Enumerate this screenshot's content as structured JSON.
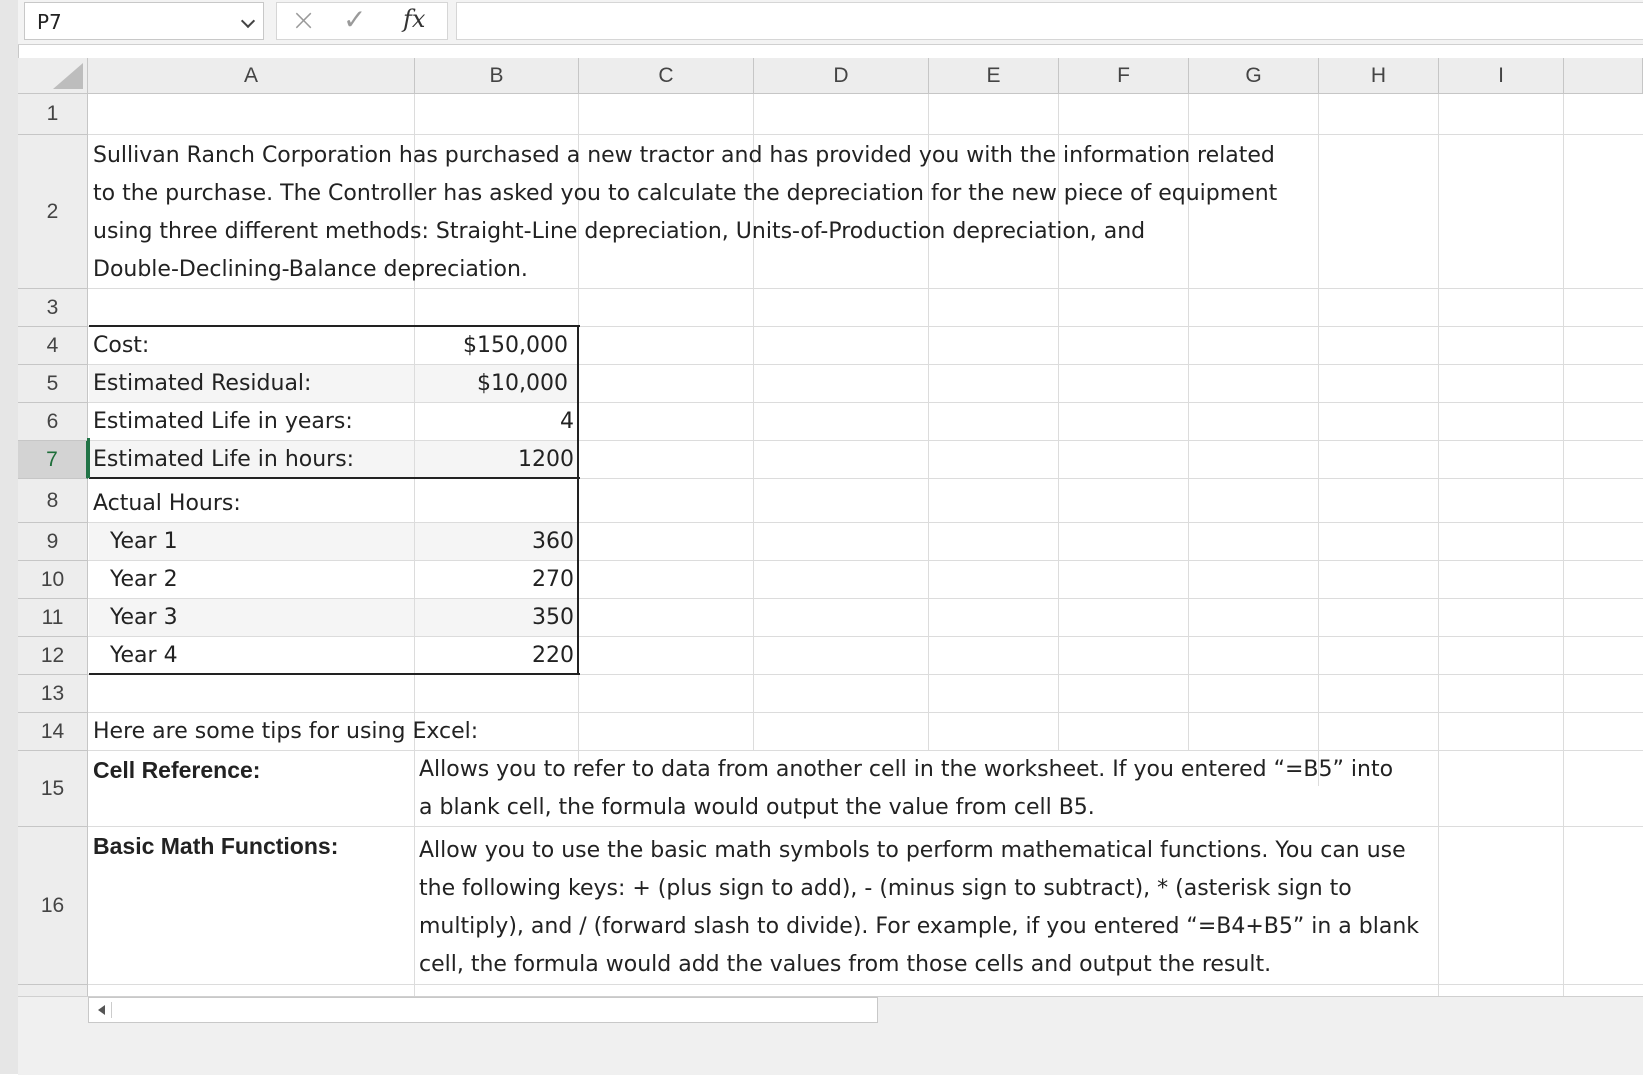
{
  "formula_bar": {
    "name_box": "P7",
    "fx_label": "fx",
    "cancel_glyph": "×",
    "enter_glyph": "✓",
    "formula": ""
  },
  "columns": [
    "A",
    "B",
    "C",
    "D",
    "E",
    "F",
    "G",
    "H",
    "I"
  ],
  "rows": [
    "1",
    "2",
    "3",
    "4",
    "5",
    "6",
    "7",
    "8",
    "9",
    "10",
    "11",
    "12",
    "13",
    "14",
    "15",
    "16"
  ],
  "selected_row": "7",
  "intro": {
    "line1": "Sullivan Ranch Corporation has purchased a new tractor and has provided you with the information related",
    "line2": "to the purchase. The Controller has asked you to calculate the depreciation for the new piece of equipment",
    "line3": "using three different methods: Straight-Line depreciation, Units-of-Production depreciation, and",
    "line4": "Double-Declining-Balance depreciation."
  },
  "table": {
    "cost_label": "Cost:",
    "cost_value": "$150,000",
    "residual_label": "Estimated Residual:",
    "residual_value": "$10,000",
    "life_years_label": "Estimated Life in years:",
    "life_years_value": "4",
    "life_hours_label": "Estimated Life in hours:",
    "life_hours_value": "1200",
    "actual_hours_label": "Actual Hours:",
    "years": [
      {
        "label": "Year 1",
        "value": "360"
      },
      {
        "label": "Year 2",
        "value": "270"
      },
      {
        "label": "Year 3",
        "value": "350"
      },
      {
        "label": "Year 4",
        "value": "220"
      }
    ]
  },
  "tips": {
    "heading": "Here are some tips for using Excel:",
    "cell_ref_label": "Cell Reference:",
    "cell_ref_line1": "Allows you to refer to data from another cell in the worksheet. If you entered “=B5” into",
    "cell_ref_line2": "a blank cell, the formula would output the value from cell B5.",
    "math_label": "Basic Math Functions:",
    "math_line1": "Allow you to use the basic math symbols to perform mathematical functions. You can use",
    "math_line2": "the following keys: + (plus sign to add), - (minus sign to subtract), * (asterisk sign to",
    "math_line3": "multiply), and / (forward slash to divide). For example, if you entered “=B4+B5” in a blank",
    "math_line4": "cell, the formula would add the values from those cells and output the result."
  }
}
